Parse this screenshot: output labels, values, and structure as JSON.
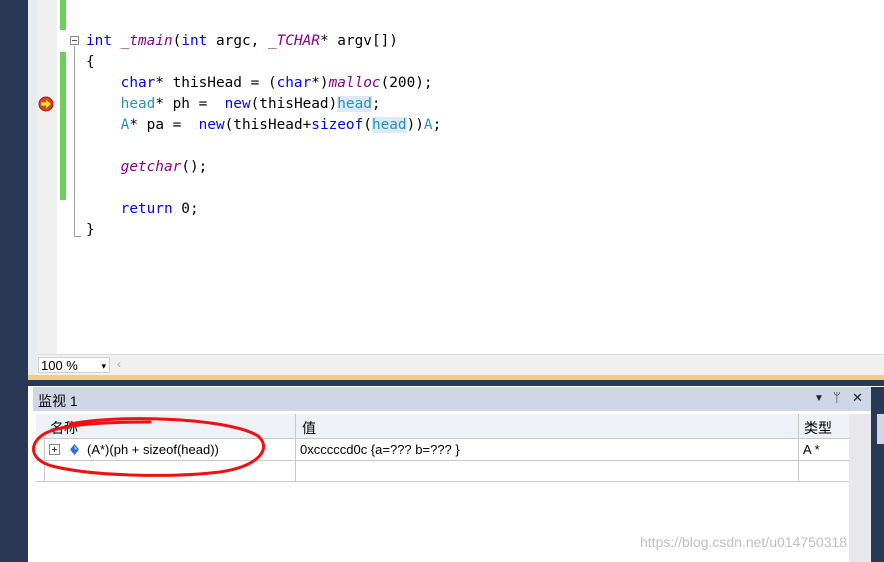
{
  "code": {
    "lines": [
      [
        {
          "t": "int",
          "c": "kw"
        },
        {
          "t": " "
        },
        {
          "t": "_tmain",
          "c": "fn"
        },
        {
          "t": "("
        },
        {
          "t": "int",
          "c": "kw"
        },
        {
          "t": " argc, "
        },
        {
          "t": "_TCHAR",
          "c": "fn"
        },
        {
          "t": "* argv[])"
        }
      ],
      [
        {
          "t": "{"
        }
      ],
      [
        {
          "t": "    "
        },
        {
          "t": "char",
          "c": "kw"
        },
        {
          "t": "* thisHead = ("
        },
        {
          "t": "char",
          "c": "kw"
        },
        {
          "t": "*)"
        },
        {
          "t": "malloc",
          "c": "fn"
        },
        {
          "t": "(200);"
        }
      ],
      [
        {
          "t": "    "
        },
        {
          "t": "head",
          "c": "ty"
        },
        {
          "t": "* ph =  "
        },
        {
          "t": "new",
          "c": "kw"
        },
        {
          "t": "(thisHead)"
        },
        {
          "t": "head",
          "c": "ty hl"
        },
        {
          "t": ";"
        }
      ],
      [
        {
          "t": "    "
        },
        {
          "t": "A",
          "c": "ty"
        },
        {
          "t": "* pa =  "
        },
        {
          "t": "new",
          "c": "kw"
        },
        {
          "t": "(thisHead+"
        },
        {
          "t": "sizeof",
          "c": "kw"
        },
        {
          "t": "("
        },
        {
          "t": "head",
          "c": "ty hl"
        },
        {
          "t": "))"
        },
        {
          "t": "A",
          "c": "ty"
        },
        {
          "t": ";"
        }
      ],
      [
        {
          "t": ""
        }
      ],
      [
        {
          "t": "    "
        },
        {
          "t": "getchar",
          "c": "fn"
        },
        {
          "t": "();"
        }
      ],
      [
        {
          "t": ""
        }
      ],
      [
        {
          "t": "    "
        },
        {
          "t": "return",
          "c": "kw"
        },
        {
          "t": " 0;"
        }
      ],
      [
        {
          "t": "}"
        }
      ]
    ]
  },
  "zoom": {
    "value": "100 %",
    "arrow": "▾",
    "scroll_left": "‹"
  },
  "watch": {
    "title": "监视 1",
    "controls": {
      "dropdown": "▼",
      "pin": "ᛘ",
      "close": "✕"
    },
    "columns": {
      "name": "名称",
      "value": "值",
      "type": "类型"
    },
    "rows": [
      {
        "name": "(A*)(ph + sizeof(head))",
        "value": "0xcccccd0c {a=??? b=??? }",
        "type": "A *"
      }
    ]
  },
  "watermark": "https://blog.csdn.net/u014750318",
  "colors": {
    "accent_red": "#ee1111",
    "ide_frame": "#293955",
    "change_bar": "#6ccf5a"
  }
}
